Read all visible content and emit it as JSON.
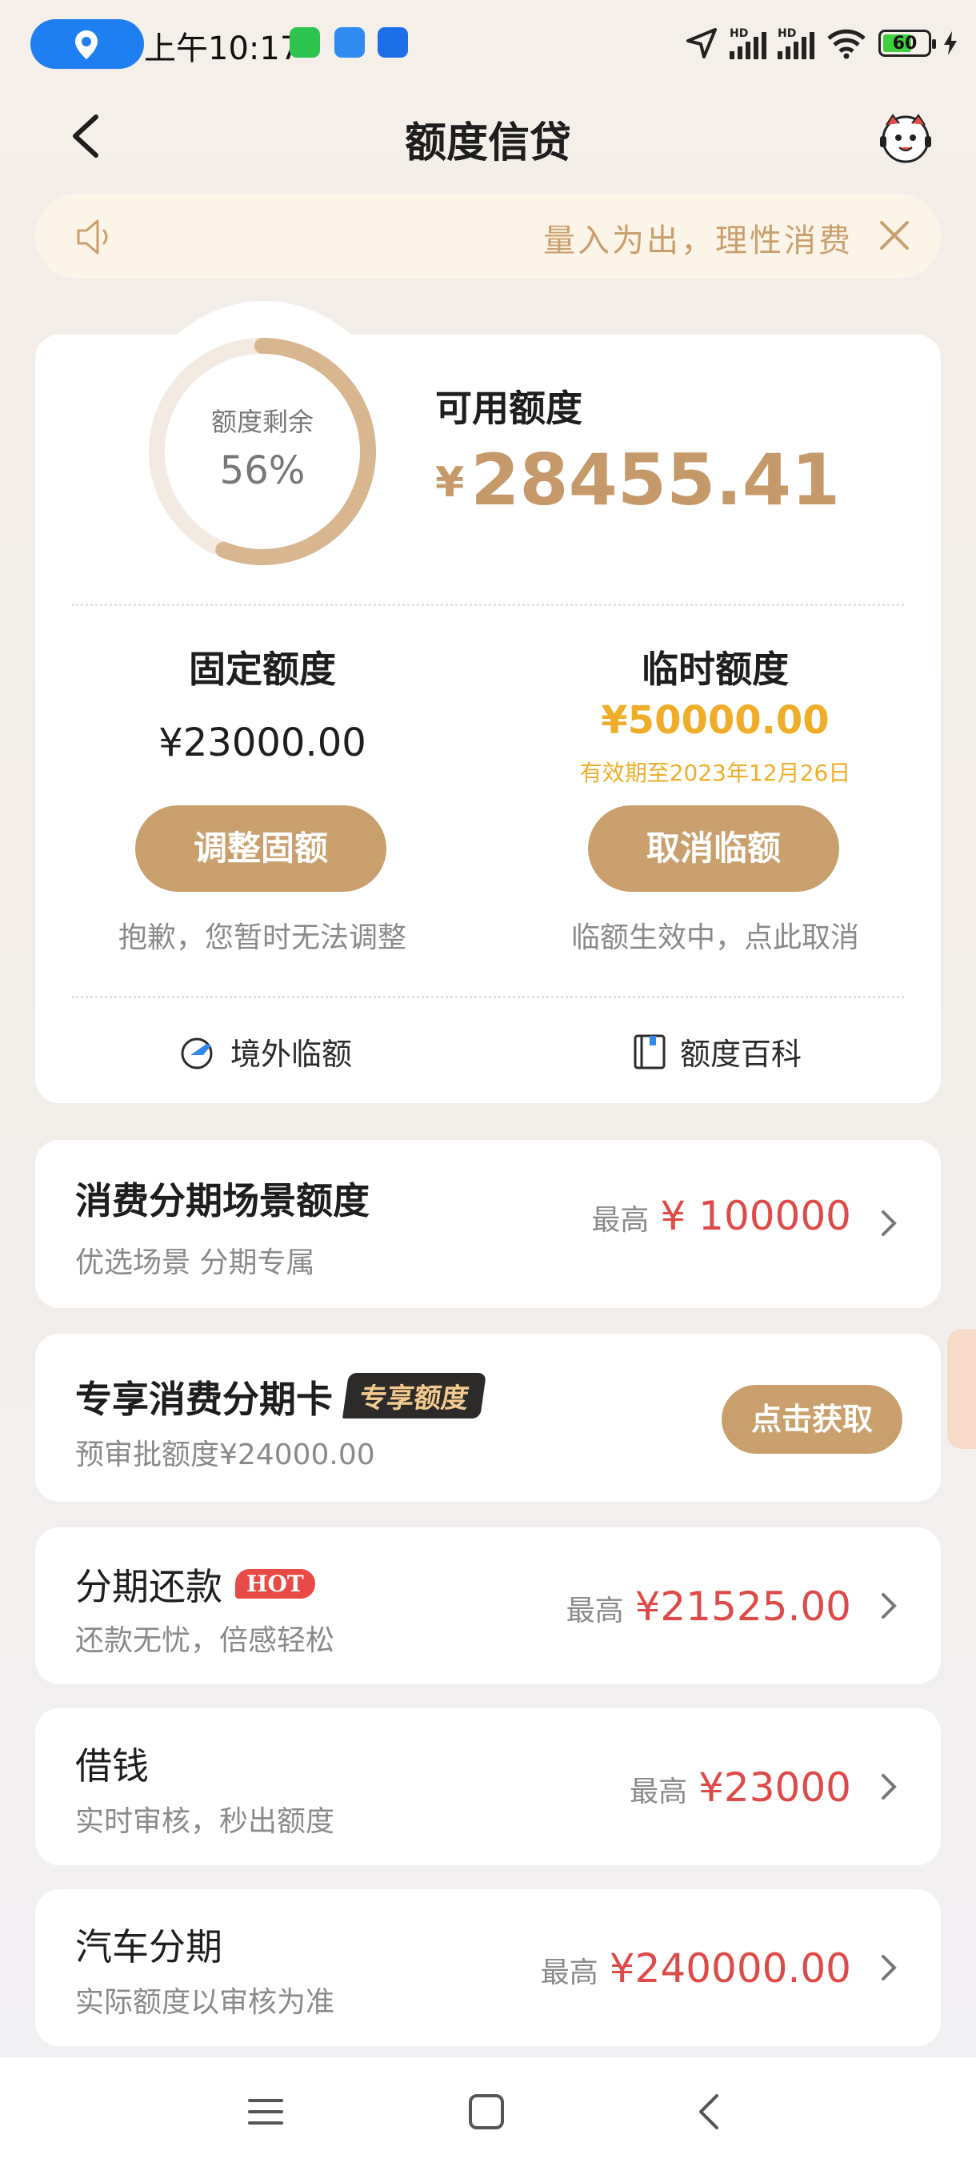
{
  "status_bar": {
    "time": "上午10:17",
    "battery": "60",
    "network_label": "HD"
  },
  "header": {
    "title": "额度信贷"
  },
  "notice": {
    "text": "量入为出，理性消费"
  },
  "credit": {
    "ring_label": "额度剩余",
    "ring_percent": "56%",
    "ring_fraction": 0.56,
    "available_label": "可用额度",
    "currency": "¥",
    "available_amount": "28455.41"
  },
  "fixed": {
    "title": "固定额度",
    "amount": "¥23000.00",
    "button": "调整固额",
    "note": "抱歉，您暂时无法调整"
  },
  "temp": {
    "title": "临时额度",
    "amount": "¥50000.00",
    "expiry": "有效期至2023年12月26日",
    "button": "取消临额",
    "note": "临额生效中，点此取消"
  },
  "links": {
    "overseas": "境外临额",
    "wiki": "额度百科"
  },
  "rows": {
    "scene": {
      "title": "消费分期场景额度",
      "sub": "优选场景 分期专属",
      "label": "最高",
      "amount": "¥ 100000"
    },
    "card": {
      "title": "专享消费分期卡",
      "badge": "专享额度",
      "sub": "预审批额度¥24000.00",
      "button": "点击获取"
    },
    "repay": {
      "title": "分期还款",
      "badge": "HOT",
      "sub": "还款无忧，倍感轻松",
      "label": "最高",
      "amount": "¥21525.00"
    },
    "borrow": {
      "title": "借钱",
      "sub": "实时审核，秒出额度",
      "label": "最高",
      "amount": "¥23000"
    },
    "car": {
      "title": "汽车分期",
      "sub": "实际额度以审核为准",
      "label": "最高",
      "amount": "¥240000.00"
    }
  },
  "colors": {
    "gold": "#c9a06d",
    "amber": "#efad2a",
    "red": "#dd4a47"
  }
}
